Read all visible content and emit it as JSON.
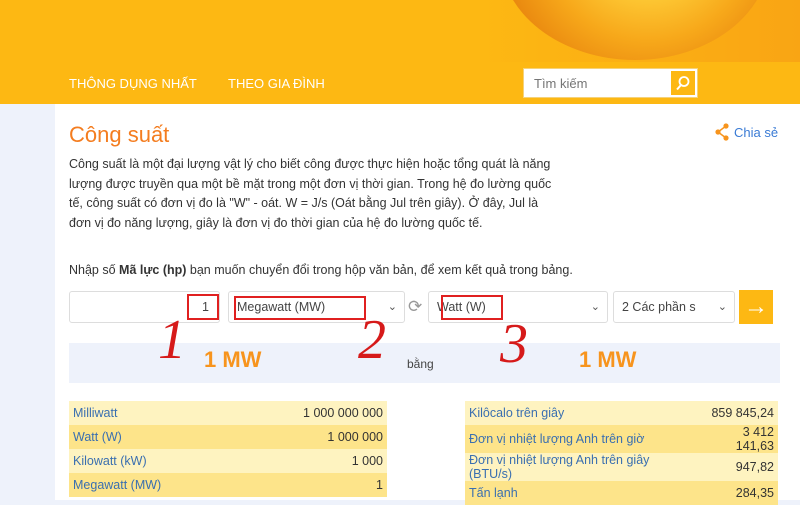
{
  "nav": {
    "items": [
      "THÔNG DỤNG NHẤT",
      "THEO GIA ĐÌNH"
    ],
    "search_placeholder": "Tìm kiếm"
  },
  "page": {
    "title": "Công suất",
    "share": "Chia sẻ",
    "description": "Công suất là một đại lượng vật lý cho biết công được thực hiện hoặc tổng quát là năng lượng được truyền qua một bề mặt trong một đơn vị thời gian. Trong hệ đo lường quốc tế, công suất có đơn vị đo là \"W\" - oát. W = J/s (Oát bằng Jul trên giây). Ở đây, Jul là đơn vị đo năng lượng, giây là đơn vị đo thời gian của hệ đo lường quốc tế.",
    "instruction_pre": "Nhập số ",
    "instruction_bold": "Mã lực (hp)",
    "instruction_post": " bạn muốn chuyển đổi trong hộp văn bản, để xem kết quả trong bảng."
  },
  "converter": {
    "value": "1",
    "from_unit": "Megawatt (MW)",
    "to_unit": "Watt (W)",
    "precision": "2 Các phần s"
  },
  "result": {
    "left": "1 MW",
    "middle": "bằng",
    "right": "1 MW"
  },
  "table_left": [
    {
      "unit": "Milliwatt",
      "value": "1 000 000 000"
    },
    {
      "unit": "Watt (W)",
      "value": "1 000 000"
    },
    {
      "unit": "Kilowatt (kW)",
      "value": "1 000"
    },
    {
      "unit": "Megawatt (MW)",
      "value": "1"
    }
  ],
  "table_right": [
    {
      "unit": "Kilôcalo trên giây",
      "value": "859 845,24"
    },
    {
      "unit": "Đơn vị nhiệt lượng Anh trên giờ",
      "value": "3 412 141,63"
    },
    {
      "unit": "Đơn vị nhiệt lượng Anh trên giây (BTU/s)",
      "value": "947,82"
    },
    {
      "unit": "Tấn lạnh",
      "value": "284,35"
    }
  ],
  "annotations": [
    "1",
    "2",
    "3"
  ],
  "colors": {
    "brand": "#fdb813",
    "title": "#f47d20",
    "annotation": "#d61a1a"
  }
}
